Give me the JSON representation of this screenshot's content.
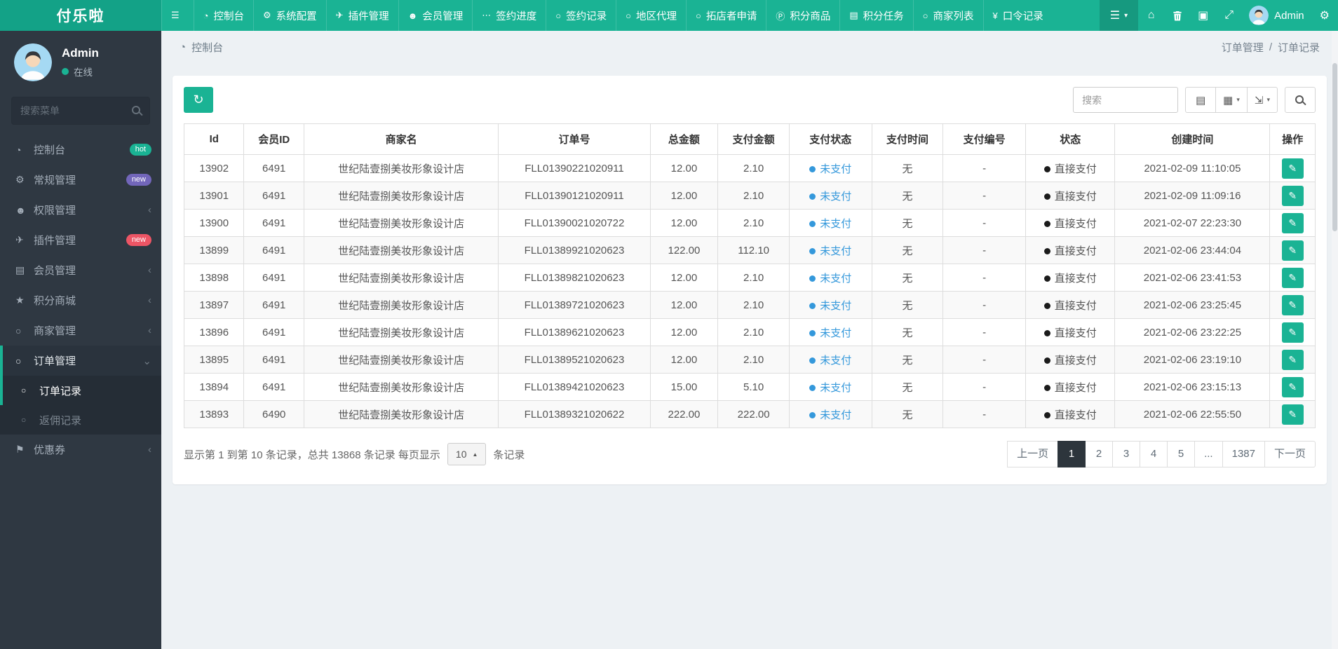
{
  "colors": {
    "accent": "#1ab394",
    "navbar": "#1ab394",
    "sidebar_bg": "#2f3842",
    "unpaid_blue": "#3498db",
    "pagination_active": "#2d353c",
    "badge_hot": "#1ab394",
    "badge_new_purple": "#7266ba",
    "badge_new_red": "#ed5565"
  },
  "icons": {
    "hamburger": "☰",
    "dashboard": "◔",
    "gear": "⚙",
    "paper-plane": "✈",
    "person": "☻",
    "ellipsis": "⋯",
    "circle-o": "○",
    "points-p": "Ⓟ",
    "tasks": "▤",
    "yen": "¥",
    "home": "⌂",
    "cache": "▣",
    "fullscreen": "⤢",
    "star": "★",
    "bookmark": "⚑",
    "refresh": "↻",
    "list-view": "▤",
    "grid": "▦",
    "export": "⇲",
    "pencil": "✎",
    "caret-down": "▾",
    "caret-up": "▲",
    "chevron-left": "‹",
    "chevron-down": "⌄",
    "search": "css-magnifier",
    "trash": "svg-trash",
    "avatar": "svg-avatar"
  },
  "top_nav": {
    "brand": "付乐啦",
    "items": [
      {
        "glyph": "☰",
        "label": ""
      },
      {
        "glyph": "◔",
        "label": "控制台"
      },
      {
        "glyph": "⚙",
        "label": "系统配置"
      },
      {
        "glyph": "✈",
        "label": "插件管理"
      },
      {
        "glyph": "☻",
        "label": "会员管理"
      },
      {
        "glyph": "⋯",
        "label": "签约进度"
      },
      {
        "glyph": "○",
        "label": "签约记录"
      },
      {
        "glyph": "○",
        "label": "地区代理"
      },
      {
        "glyph": "○",
        "label": "拓店者申请"
      },
      {
        "glyph": "Ⓟ",
        "label": "积分商品"
      },
      {
        "glyph": "▤",
        "label": "积分任务"
      },
      {
        "glyph": "○",
        "label": "商家列表"
      },
      {
        "glyph": "¥",
        "label": "口令记录"
      }
    ],
    "right": {
      "menu_glyph": "☰",
      "caret": "▾",
      "home_glyph": "⌂",
      "cache_glyph": "▣",
      "fullscreen_glyph": "⤢",
      "user": "Admin",
      "gear_glyph": "⚙"
    }
  },
  "sidebar": {
    "profile": {
      "name": "Admin",
      "status": "在线"
    },
    "search_placeholder": "搜索菜单",
    "items": [
      {
        "glyph": "◔",
        "label": "控制台",
        "badge": "hot"
      },
      {
        "glyph": "⚙",
        "label": "常规管理",
        "badge": "new"
      },
      {
        "glyph": "☻",
        "label": "权限管理",
        "chevron": "‹"
      },
      {
        "glyph": "✈",
        "label": "插件管理",
        "badge": "new"
      },
      {
        "glyph": "▤",
        "label": "会员管理",
        "chevron": "‹"
      },
      {
        "glyph": "★",
        "label": "积分商城",
        "chevron": "‹"
      },
      {
        "glyph": "○",
        "label": "商家管理",
        "chevron": "‹"
      },
      {
        "glyph": "○",
        "label": "订单管理",
        "chevron": "⌄",
        "state": "active"
      },
      {
        "glyph": "⚑",
        "label": "优惠券",
        "chevron": "‹"
      }
    ],
    "submenu": [
      {
        "glyph": "○",
        "label": "订单记录",
        "state": "active"
      },
      {
        "glyph": "○",
        "label": "返佣记录"
      }
    ]
  },
  "breadcrumb": {
    "icon_glyph": "◔",
    "section": "控制台",
    "trail_parent": "订单管理",
    "trail_sep": "/",
    "trail_current": "订单记录"
  },
  "toolbar": {
    "refresh_glyph": "↻",
    "search_placeholder": "搜索",
    "view_glyph": "▤",
    "grid_glyph": "▦",
    "export_glyph": "⇲",
    "caret": "▾"
  },
  "table": {
    "edit_glyph": "✎",
    "columns": [
      "Id",
      "会员ID",
      "商家名",
      "订单号",
      "总金额",
      "支付金额",
      "支付状态",
      "支付时间",
      "支付编号",
      "状态",
      "创建时间",
      "操作"
    ],
    "rows": [
      {
        "id": "13902",
        "member_id": "6491",
        "merchant": "世纪陆壹捌美妆形象设计店",
        "order_no": "FLL01390221020911",
        "total": "12.00",
        "paid": "2.10",
        "pay_status": "未支付",
        "pay_time": "无",
        "pay_no": "-",
        "status": "直接支付",
        "created": "2021-02-09 11:10:05"
      },
      {
        "id": "13901",
        "member_id": "6491",
        "merchant": "世纪陆壹捌美妆形象设计店",
        "order_no": "FLL01390121020911",
        "total": "12.00",
        "paid": "2.10",
        "pay_status": "未支付",
        "pay_time": "无",
        "pay_no": "-",
        "status": "直接支付",
        "created": "2021-02-09 11:09:16"
      },
      {
        "id": "13900",
        "member_id": "6491",
        "merchant": "世纪陆壹捌美妆形象设计店",
        "order_no": "FLL01390021020722",
        "total": "12.00",
        "paid": "2.10",
        "pay_status": "未支付",
        "pay_time": "无",
        "pay_no": "-",
        "status": "直接支付",
        "created": "2021-02-07 22:23:30"
      },
      {
        "id": "13899",
        "member_id": "6491",
        "merchant": "世纪陆壹捌美妆形象设计店",
        "order_no": "FLL01389921020623",
        "total": "122.00",
        "paid": "112.10",
        "pay_status": "未支付",
        "pay_time": "无",
        "pay_no": "-",
        "status": "直接支付",
        "created": "2021-02-06 23:44:04"
      },
      {
        "id": "13898",
        "member_id": "6491",
        "merchant": "世纪陆壹捌美妆形象设计店",
        "order_no": "FLL01389821020623",
        "total": "12.00",
        "paid": "2.10",
        "pay_status": "未支付",
        "pay_time": "无",
        "pay_no": "-",
        "status": "直接支付",
        "created": "2021-02-06 23:41:53"
      },
      {
        "id": "13897",
        "member_id": "6491",
        "merchant": "世纪陆壹捌美妆形象设计店",
        "order_no": "FLL01389721020623",
        "total": "12.00",
        "paid": "2.10",
        "pay_status": "未支付",
        "pay_time": "无",
        "pay_no": "-",
        "status": "直接支付",
        "created": "2021-02-06 23:25:45"
      },
      {
        "id": "13896",
        "member_id": "6491",
        "merchant": "世纪陆壹捌美妆形象设计店",
        "order_no": "FLL01389621020623",
        "total": "12.00",
        "paid": "2.10",
        "pay_status": "未支付",
        "pay_time": "无",
        "pay_no": "-",
        "status": "直接支付",
        "created": "2021-02-06 23:22:25"
      },
      {
        "id": "13895",
        "member_id": "6491",
        "merchant": "世纪陆壹捌美妆形象设计店",
        "order_no": "FLL01389521020623",
        "total": "12.00",
        "paid": "2.10",
        "pay_status": "未支付",
        "pay_time": "无",
        "pay_no": "-",
        "status": "直接支付",
        "created": "2021-02-06 23:19:10"
      },
      {
        "id": "13894",
        "member_id": "6491",
        "merchant": "世纪陆壹捌美妆形象设计店",
        "order_no": "FLL01389421020623",
        "total": "15.00",
        "paid": "5.10",
        "pay_status": "未支付",
        "pay_time": "无",
        "pay_no": "-",
        "status": "直接支付",
        "created": "2021-02-06 23:15:13"
      },
      {
        "id": "13893",
        "member_id": "6490",
        "merchant": "世纪陆壹捌美妆形象设计店",
        "order_no": "FLL01389321020622",
        "total": "222.00",
        "paid": "222.00",
        "pay_status": "未支付",
        "pay_time": "无",
        "pay_no": "-",
        "status": "直接支付",
        "created": "2021-02-06 22:55:50"
      }
    ]
  },
  "footer": {
    "info": "显示第 1 到第 10 条记录，总共 13868 条记录 每页显示",
    "page_size": "10",
    "caret_up": "▲",
    "info_suffix": "条记录",
    "pages": [
      {
        "label": "上一页"
      },
      {
        "label": "1",
        "state": "active"
      },
      {
        "label": "2"
      },
      {
        "label": "3"
      },
      {
        "label": "4"
      },
      {
        "label": "5"
      },
      {
        "label": "..."
      },
      {
        "label": "1387"
      },
      {
        "label": "下一页"
      }
    ]
  }
}
